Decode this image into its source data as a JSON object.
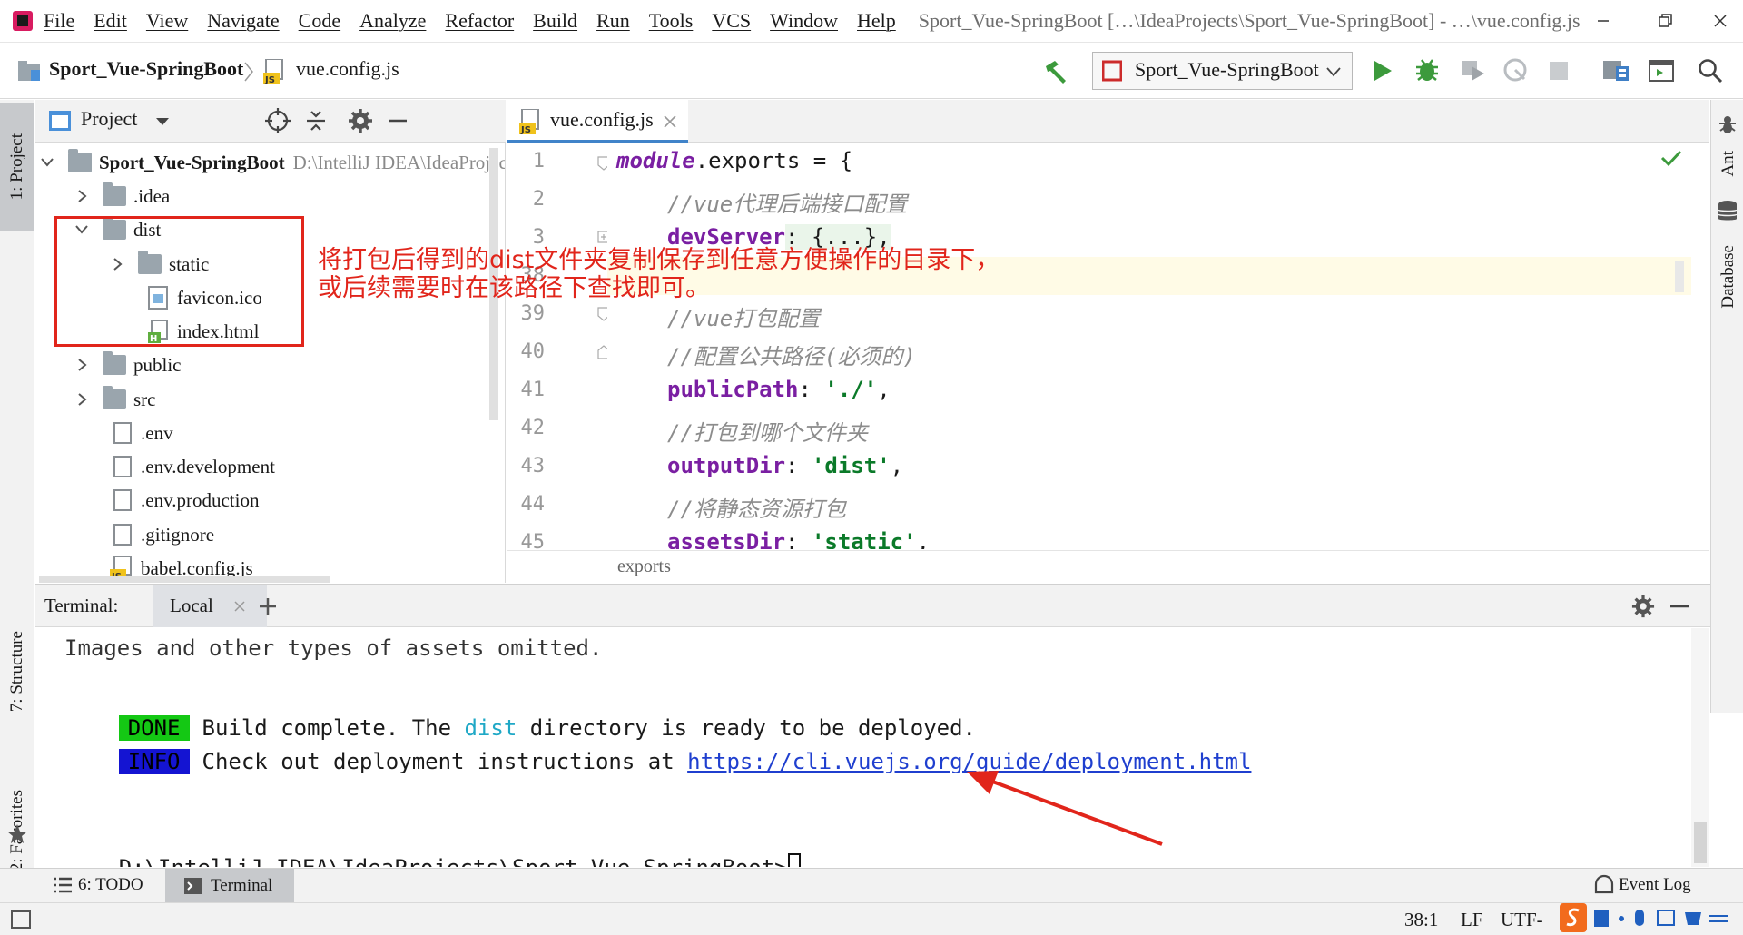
{
  "menu": {
    "items": [
      "File",
      "Edit",
      "View",
      "Navigate",
      "Code",
      "Analyze",
      "Refactor",
      "Build",
      "Run",
      "Tools",
      "VCS",
      "Window",
      "Help"
    ],
    "window_title": "Sport_Vue-SpringBoot […\\IdeaProjects\\Sport_Vue-SpringBoot] - …\\vue.config.js"
  },
  "navbar": {
    "project": "Sport_Vue-SpringBoot",
    "file": "vue.config.js",
    "run_config": "Sport_Vue-SpringBoot"
  },
  "left_strip": {
    "project_tab": "1: Project",
    "structure_tab": "7: Structure",
    "favorites_tab": "2: Favorites"
  },
  "right_strip": {
    "ant_tab": "Ant",
    "database_tab": "Database"
  },
  "project_panel": {
    "title": "Project",
    "root_name": "Sport_Vue-SpringBoot",
    "root_path": "D:\\IntelliJ IDEA\\IdeaProjects\\Sport_Vue-SpringBoot",
    "items": [
      ".idea",
      "dist",
      "static",
      "favicon.ico",
      "index.html",
      "public",
      "src",
      ".env",
      ".env.development",
      ".env.production",
      ".gitignore",
      "babel.config.js"
    ]
  },
  "editor": {
    "tab": "vue.config.js",
    "line_numbers": [
      "1",
      "2",
      "3",
      "38",
      "39",
      "40",
      "41",
      "42",
      "43",
      "44",
      "45"
    ],
    "breadcrumb": "exports",
    "code": {
      "l1_kw": "module",
      "l1_rest": ".exports = {",
      "l2": "//vue代理后端接口配置",
      "l3_key": "devServer",
      "l3_rest": ": {...},",
      "l39": "//vue打包配置",
      "l40": "//配置公共路径(必须的)",
      "l41_key": "publicPath",
      "l41_val": "'./'",
      "l42": "//打包到哪个文件夹",
      "l43_key": "outputDir",
      "l43_val": "'dist'",
      "l44": "//将静态资源打包",
      "l45_key": "assetsDir",
      "l45_val": "'static'"
    }
  },
  "terminal": {
    "label": "Terminal:",
    "tab": "Local",
    "line1": "Images and other types of assets omitted.",
    "done_badge": "DONE",
    "done_pre": "Build complete. The ",
    "done_dist": "dist",
    "done_post": " directory is ready to be deployed.",
    "info_badge": "INFO",
    "info_pre": "Check out deployment instructions at ",
    "info_link": "https://cli.vuejs.org/guide/deployment.html",
    "prompt": "D:\\IntelliJ IDEA\\IdeaProjects\\Sport_Vue-SpringBoot>"
  },
  "bottom_tools": {
    "todo": "6: TODO",
    "terminal": "Terminal",
    "event_log": "Event Log"
  },
  "status": {
    "position": "38:1",
    "line_sep": "LF",
    "encoding": "UTF-"
  },
  "annotation": {
    "line1": "将打包后得到的dist文件夹复制保存到任意方便操作的目录下，",
    "line2": "或后续需要时在该路径下查找即可。"
  },
  "colors": {
    "done_bg": "#14c814",
    "info_bg": "#1414d2",
    "annotation": "#e1251b",
    "keyword": "#7a1fa2",
    "string": "#0b7a29"
  }
}
